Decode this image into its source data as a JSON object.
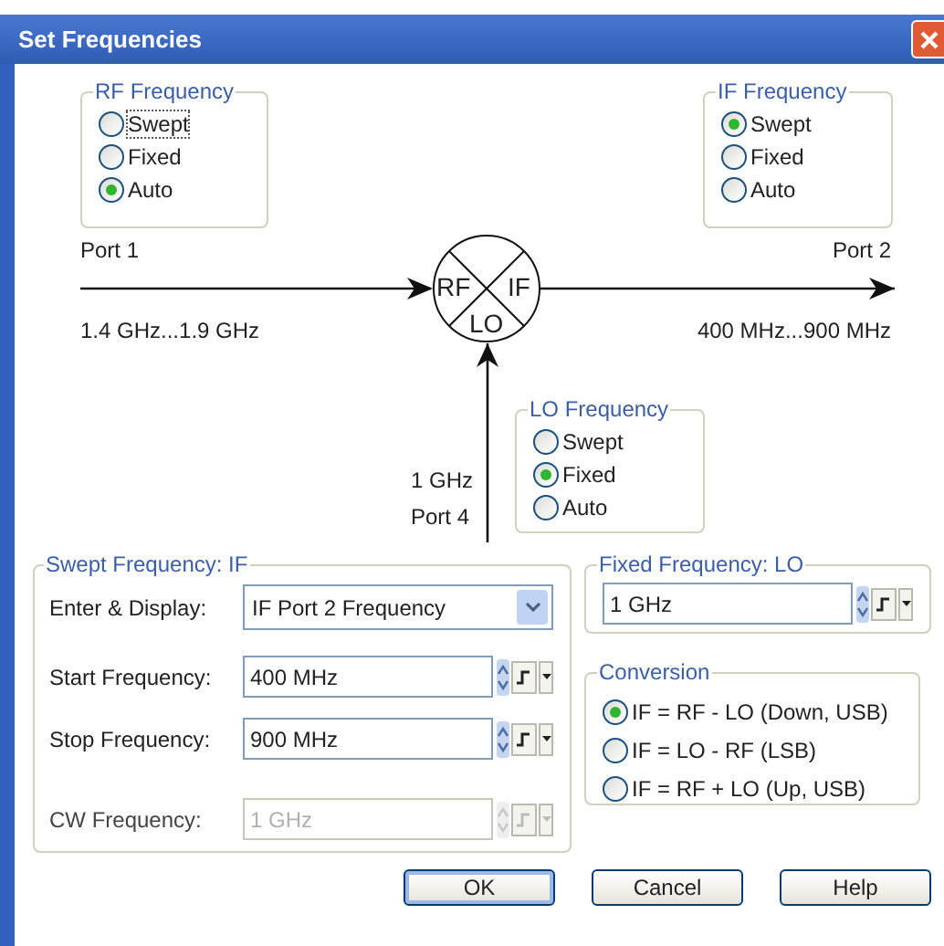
{
  "window": {
    "title": "Set Frequencies"
  },
  "diagram": {
    "groups": [
      {
        "kind": "rf",
        "title": "RF Frequency",
        "options": [
          {
            "label": "Swept",
            "selected": false,
            "focused": true
          },
          {
            "label": "Fixed",
            "selected": false,
            "focused": false
          },
          {
            "label": "Auto",
            "selected": true,
            "focused": false
          }
        ]
      },
      {
        "kind": "if",
        "title": "IF Frequency",
        "options": [
          {
            "label": "Swept",
            "selected": true,
            "focused": false
          },
          {
            "label": "Fixed",
            "selected": false,
            "focused": false
          },
          {
            "label": "Auto",
            "selected": false,
            "focused": false
          }
        ]
      },
      {
        "kind": "lo",
        "title": "LO Frequency",
        "options": [
          {
            "label": "Swept",
            "selected": false,
            "focused": false
          },
          {
            "label": "Fixed",
            "selected": true,
            "focused": false
          },
          {
            "label": "Auto",
            "selected": false,
            "focused": false
          }
        ]
      }
    ],
    "mixer": {
      "rf": "RF",
      "if": "IF",
      "lo": "LO"
    },
    "input": {
      "port": "Port 1",
      "range": "1.4 GHz...1.9 GHz"
    },
    "output": {
      "port": "Port 2",
      "range": "400 MHz...900 MHz"
    },
    "lo_input": {
      "value": "1 GHz",
      "port": "Port 4"
    }
  },
  "swept_frequency": {
    "title": "Swept Frequency: IF",
    "rows": [
      {
        "kind": "dropdown",
        "label": "Enter & Display:",
        "value": "IF Port 2 Frequency",
        "disabled": false
      },
      {
        "kind": "field",
        "label": "Start Frequency:",
        "value": "400 MHz",
        "disabled": false
      },
      {
        "kind": "field",
        "label": "Stop Frequency:",
        "value": "900 MHz",
        "disabled": false
      },
      {
        "kind": "field",
        "label": "CW Frequency:",
        "value": "1 GHz",
        "disabled": true
      }
    ]
  },
  "fixed_frequency": {
    "title": "Fixed Frequency: LO",
    "value": "1 GHz"
  },
  "conversion": {
    "title": "Conversion",
    "options": [
      {
        "label": "IF = RF - LO (Down, USB)",
        "selected": true
      },
      {
        "label": "IF = LO - RF (LSB)",
        "selected": false
      },
      {
        "label": "IF = RF + LO (Up, USB)",
        "selected": false
      }
    ]
  },
  "buttons": [
    {
      "label": "OK",
      "default": true
    },
    {
      "label": "Cancel",
      "default": false
    },
    {
      "label": "Help",
      "default": false
    }
  ]
}
